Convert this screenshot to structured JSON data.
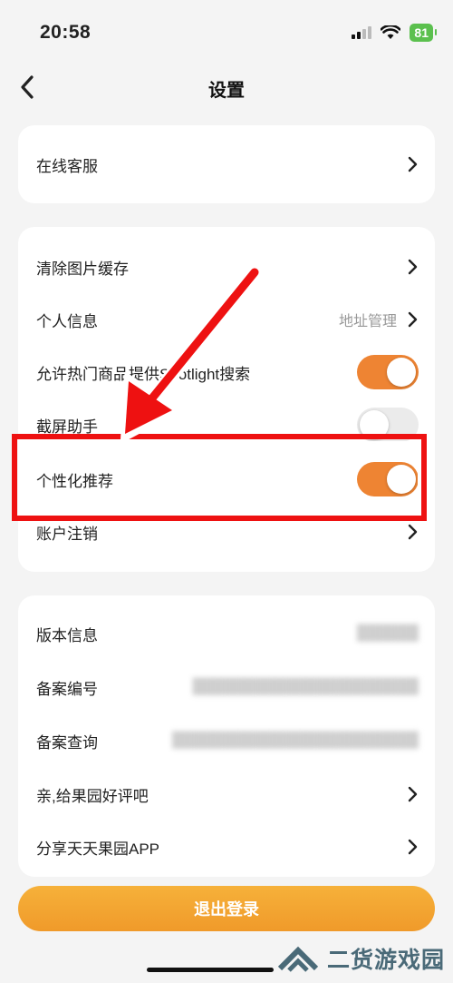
{
  "status_bar": {
    "time": "20:58",
    "battery": "81",
    "icons": [
      "signal-icon",
      "wifi-icon",
      "battery-icon"
    ]
  },
  "nav": {
    "title": "设置",
    "back_icon": "chevron-left-icon"
  },
  "section1": [
    {
      "label": "在线客服",
      "icon": "chevron-right-icon"
    }
  ],
  "section2": [
    {
      "label": "清除图片缓存",
      "icon": "chevron-right-icon"
    },
    {
      "label": "个人信息",
      "value": "地址管理",
      "icon": "chevron-right-icon"
    },
    {
      "label": "允许热门商品提供Spotlight搜索",
      "toggle": "on"
    },
    {
      "label": "截屏助手",
      "toggle": "off"
    },
    {
      "label": "个性化推荐",
      "toggle": "on"
    },
    {
      "label": "账户注销",
      "icon": "chevron-right-icon"
    }
  ],
  "section3": [
    {
      "label": "版本信息",
      "value": "(blurred)"
    },
    {
      "label": "备案编号",
      "value": "(blurred)"
    },
    {
      "label": "备案查询",
      "value": "(blurred)"
    },
    {
      "label": "亲,给果园好评吧",
      "icon": "chevron-right-icon"
    },
    {
      "label": "分享天天果园APP",
      "icon": "chevron-right-icon"
    }
  ],
  "logout_label": "退出登录",
  "watermark": {
    "text": "二货游戏园",
    "icon": "logo-icon"
  },
  "colors": {
    "accent": "#ee8433",
    "highlight": "#ee1111",
    "background": "#f4f4f4",
    "battery": "#5bc04e"
  }
}
